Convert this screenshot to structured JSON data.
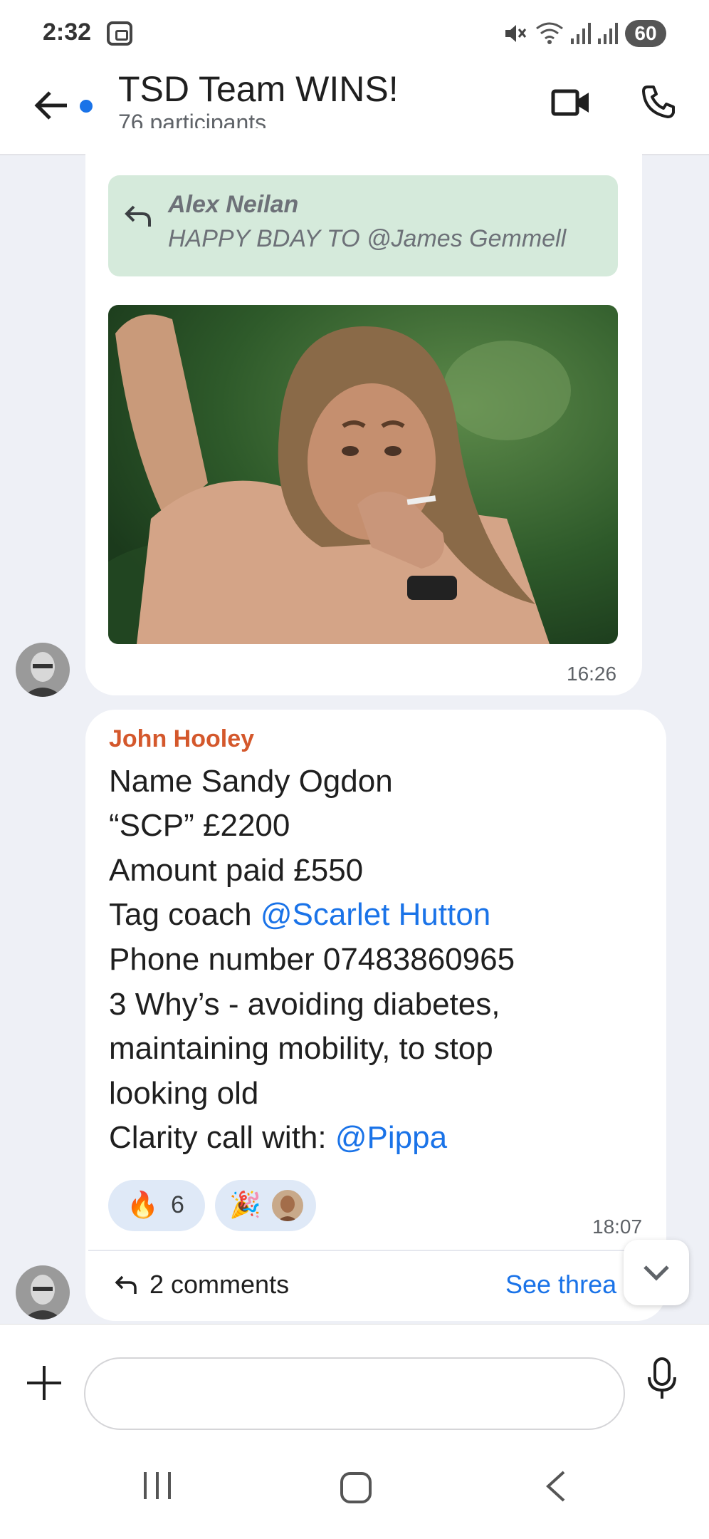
{
  "status_bar": {
    "time": "2:32",
    "battery": "60"
  },
  "header": {
    "title": "TSD Team WINS!",
    "subtitle": "76 participants"
  },
  "messages": [
    {
      "reply_to": {
        "author": "Alex Neilan",
        "text": "HAPPY BDAY TO @James Gemmell"
      },
      "attachment": "gif-image",
      "time": "16:26"
    },
    {
      "sender": "John Hooley",
      "lines": [
        "Name Sandy Ogdon",
        "“SCP” £2200",
        "Amount paid £550",
        "Tag coach ",
        "Phone number 07483860965",
        "3 Why’s - avoiding diabetes,",
        "maintaining mobility, to stop",
        "looking old",
        "Clarity call with: "
      ],
      "mentions": {
        "coach": "@Scarlet Hutton",
        "clarity": "@Pippa"
      },
      "reactions": [
        {
          "emoji": "🔥",
          "count": "6"
        },
        {
          "emoji": "🎉",
          "reactor": "avatar"
        }
      ],
      "time": "18:07",
      "thread": {
        "comments": "2 comments",
        "link": "See threa"
      }
    }
  ],
  "composer": {
    "value": "",
    "placeholder": ""
  },
  "colors": {
    "sender_name": "#d4582c",
    "mention": "#1a73e8",
    "reply_bg": "#d5eadb",
    "reaction_bg": "#dfe9f7"
  }
}
